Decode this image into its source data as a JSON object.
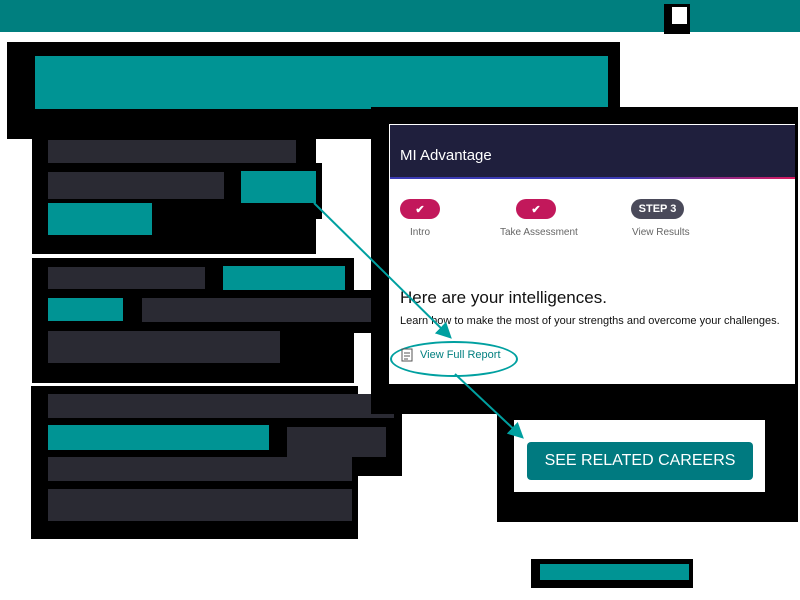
{
  "mi": {
    "title": "MI Advantage",
    "steps": [
      {
        "label": "Intro",
        "badge": "✔"
      },
      {
        "label": "Take Assessment",
        "badge": "✔"
      },
      {
        "label": "View Results",
        "badge": "STEP 3"
      }
    ],
    "heading": "Here are your intelligences.",
    "subheading": "Learn how to make the most of your strengths and overcome your challenges.",
    "report_link": "View Full Report"
  },
  "cta": {
    "label": "SEE RELATED CAREERS"
  },
  "colors": {
    "teal": "#009494",
    "navy": "#1f1f3d",
    "pink": "#c2185b",
    "cta": "#007a80"
  }
}
